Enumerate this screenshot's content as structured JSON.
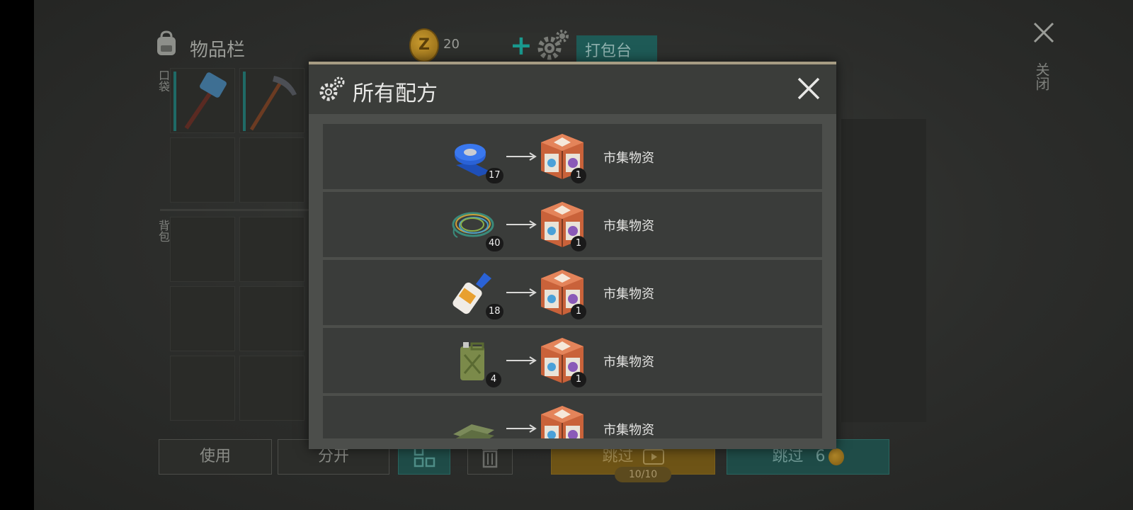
{
  "background": {
    "inventory_title": "物品栏",
    "coin": {
      "symbol": "Z",
      "amount": "20",
      "plus": "+"
    },
    "craft_tab_label": "打包台",
    "close_label": "关闭",
    "pocket_label": "口袋",
    "backpack_label": "背包",
    "buttons": {
      "use": "使用",
      "split": "分开",
      "skip_ad": "跳过",
      "skip_ad_counter": "10/10",
      "skip_coin": "跳过",
      "skip_coin_cost": "6"
    }
  },
  "modal": {
    "title": "所有配方",
    "recipes": [
      {
        "ingredient": "duct-tape",
        "ingredient_qty": "17",
        "output_qty": "1",
        "output_name": "市集物资"
      },
      {
        "ingredient": "wire-coil",
        "ingredient_qty": "40",
        "output_qty": "1",
        "output_name": "市集物资"
      },
      {
        "ingredient": "glue-tube",
        "ingredient_qty": "18",
        "output_qty": "1",
        "output_name": "市集物资"
      },
      {
        "ingredient": "jerrycan",
        "ingredient_qty": "4",
        "output_qty": "1",
        "output_name": "市集物资"
      },
      {
        "ingredient": "cloth-fabric",
        "ingredient_qty": "",
        "output_qty": "",
        "output_name": "市集物资"
      }
    ]
  },
  "colors": {
    "accent_teal": "#1f4c48",
    "accent_yellow": "#6e5416",
    "modal_border": "#a69c83"
  }
}
